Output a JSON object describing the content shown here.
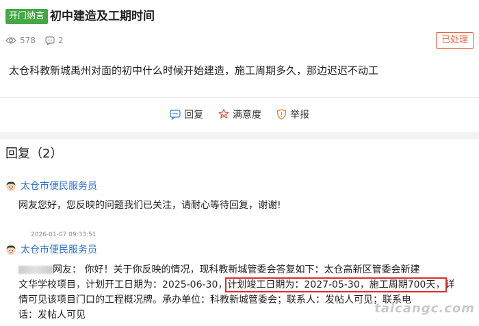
{
  "header": {
    "tag": "开门纳言",
    "title": "初中建造及工期时间",
    "views": "578",
    "comments": "2",
    "status": "已处理"
  },
  "question": "太仓科教新城禹州对面的初中什么时候开始建造，施工周期多久，那边迟迟不动工",
  "actions": {
    "reply": "回复",
    "satisfaction": "满意度",
    "report": "举报"
  },
  "replies_heading": "回复（2）",
  "replies": [
    {
      "name": "太仓市便民服务员",
      "text": "网友您好，您反映的问题我们已关注，请耐心等待回复，谢谢!",
      "time": "2026-01-07 09:33:51"
    },
    {
      "name": "太仓市便民服务员",
      "text_a": "网友：  你好！关于你反映的情况，现科教新城管委会答复如下：太仓高新区管委会新建",
      "text_b1": "文华学校项目，计划开工日期为：2025-06-30，",
      "text_b_highlight": "计划竣工日期为：2027-05-30，施工周期700天，",
      "text_b2": "详",
      "text_c": "情可见该项目门口的工程概况牌。承办单位：科教新城管委会；联系人：发帖人可见；联系电",
      "text_d": "话：发帖人可见"
    }
  ],
  "watermark": "taicangc.com",
  "icons": {
    "views": "eye-icon",
    "comments": "comment-icon",
    "reply": "reply-icon",
    "satisfaction": "satisfaction-icon",
    "report": "warning-icon",
    "avatar": "avatar-icon"
  },
  "colors": {
    "tag_bg": "#45a845",
    "status": "#e8643f",
    "link": "#2a6fd1",
    "highlight": "#e02b2b"
  }
}
